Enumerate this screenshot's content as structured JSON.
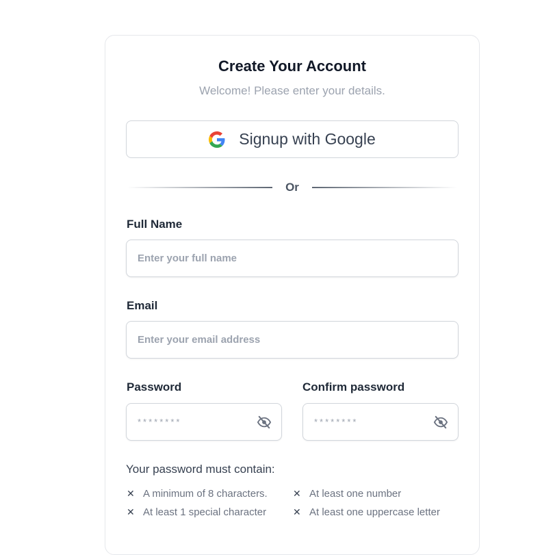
{
  "header": {
    "title": "Create Your Account",
    "subtitle": "Welcome! Please enter your details."
  },
  "google_button": {
    "label": "Signup with Google",
    "icon": "google-icon"
  },
  "divider": {
    "text": "Or"
  },
  "fields": {
    "full_name": {
      "label": "Full Name",
      "value": "",
      "placeholder": "Enter your full name"
    },
    "email": {
      "label": "Email",
      "value": "",
      "placeholder": "Enter your email address"
    },
    "password": {
      "label": "Password",
      "value": "",
      "placeholder": "********",
      "toggle_icon": "eye-off-icon"
    },
    "confirm_password": {
      "label": "Confirm password",
      "value": "",
      "placeholder": "********",
      "toggle_icon": "eye-off-icon"
    }
  },
  "requirements": {
    "title": "Your password must contain:",
    "items": [
      {
        "text": "A minimum of 8 characters.",
        "icon": "x-icon",
        "met": false
      },
      {
        "text": "At least one number",
        "icon": "x-icon",
        "met": false
      },
      {
        "text": "At least 1 special character",
        "icon": "x-icon",
        "met": false
      },
      {
        "text": "At least one uppercase letter",
        "icon": "x-icon",
        "met": false
      }
    ]
  },
  "colors": {
    "title": "#111827",
    "muted": "#9ca3af",
    "border": "#d1d5db"
  }
}
